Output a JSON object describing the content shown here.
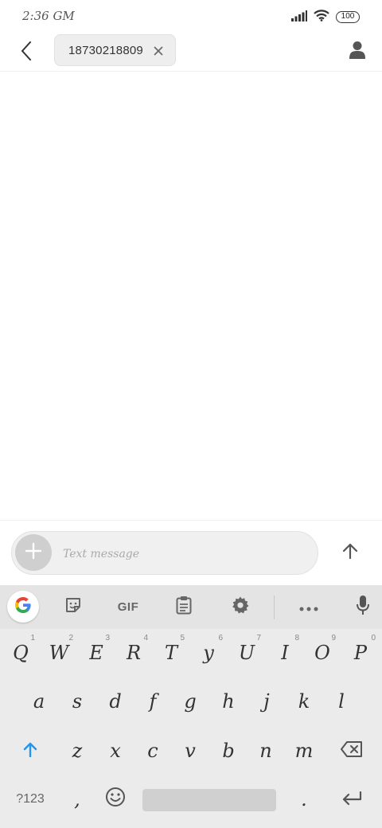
{
  "status_bar": {
    "time": "2:36 GM",
    "battery": "100",
    "icons": [
      "signal-icon",
      "wifi-icon",
      "battery-icon"
    ]
  },
  "header": {
    "back_icon": "back-arrow-icon",
    "recipient": "18730218809",
    "remove_icon": "close-icon",
    "contact_icon": "person-icon"
  },
  "compose": {
    "placeholder": "Text message",
    "add_icon": "plus-icon",
    "send_icon": "arrow-up-icon"
  },
  "keyboard": {
    "toolbar": {
      "google_icon": "google-g-icon",
      "sticker_icon": "sticker-icon",
      "gif_label": "GIF",
      "clipboard_icon": "clipboard-icon",
      "settings_icon": "gear-icon",
      "more_icon": "more-horizontal-icon",
      "mic_icon": "microphone-icon"
    },
    "row1": [
      {
        "label": "Q",
        "hint": "1"
      },
      {
        "label": "W",
        "hint": "2"
      },
      {
        "label": "E",
        "hint": "3"
      },
      {
        "label": "R",
        "hint": "4"
      },
      {
        "label": "T",
        "hint": "5"
      },
      {
        "label": "y",
        "hint": "6"
      },
      {
        "label": "U",
        "hint": "7"
      },
      {
        "label": "I",
        "hint": "8"
      },
      {
        "label": "O",
        "hint": "9"
      },
      {
        "label": "P",
        "hint": "0"
      }
    ],
    "row2": [
      "a",
      "s",
      "d",
      "f",
      "g",
      "h",
      "j",
      "k",
      "l"
    ],
    "row3": [
      "z",
      "x",
      "c",
      "v",
      "b",
      "n",
      "m"
    ],
    "shift_icon": "shift-arrow-icon",
    "backspace_icon": "backspace-icon",
    "symbols_label": "?123",
    "comma_label": ",",
    "emoji_icon": "emoji-icon",
    "period_label": ".",
    "enter_icon": "enter-icon"
  },
  "colors": {
    "accent": "#2196f3",
    "keyboard_bg": "#ebebeb",
    "chip_bg": "#eeeeee"
  }
}
